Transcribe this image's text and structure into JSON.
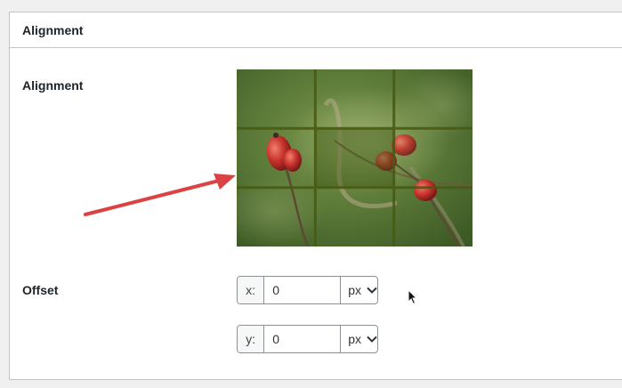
{
  "panel": {
    "title": "Alignment"
  },
  "alignment": {
    "label": "Alignment",
    "image_alt": "rose hips on branch with 3x3 alignment grid",
    "selected_cell": "center"
  },
  "offset": {
    "label": "Offset",
    "x": {
      "prefix": "x:",
      "value": "0",
      "unit": "px"
    },
    "y": {
      "prefix": "y:",
      "value": "0",
      "unit": "px"
    }
  },
  "icons": {
    "arrow": "red-arrow-icon",
    "chevron": "chevron-down-icon",
    "cursor": "mouse-pointer-icon"
  },
  "colors": {
    "arrow": "#d94343",
    "grid_line": "#4a5a10",
    "border": "#c3c4c7"
  }
}
